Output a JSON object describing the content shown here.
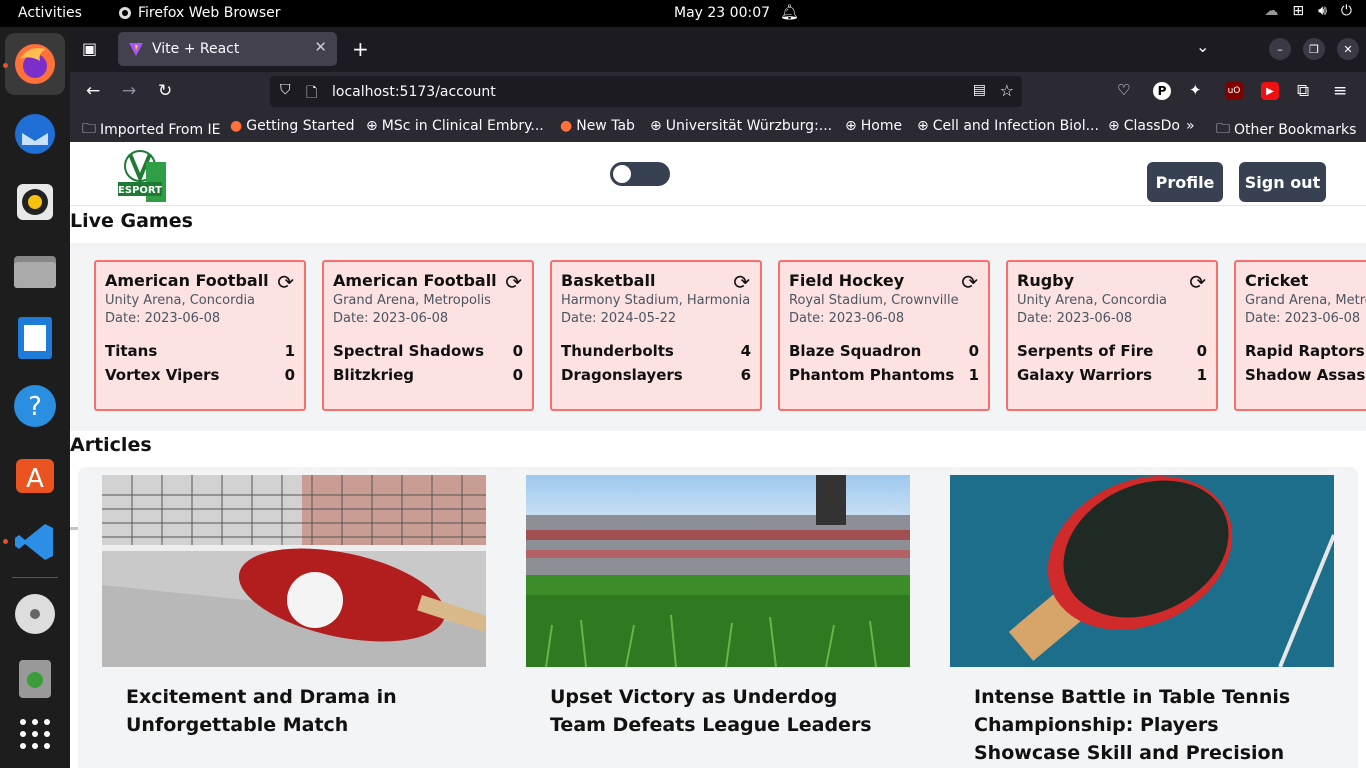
{
  "topbar": {
    "activities": "Activities",
    "app_name": "Firefox Web Browser",
    "clock": "May 23  00:07"
  },
  "browser": {
    "tab_title": "Vite + React",
    "url": "localhost:5173/account",
    "bookmarks": [
      "Imported From IE",
      "Getting Started",
      "MSc in Clinical Embry...",
      "New Tab",
      "Universität Würzburg:...",
      "Home",
      "Cell and Infection Biol...",
      "ClassDo",
      "Other Bookmarks"
    ]
  },
  "app": {
    "logo_text": "ESPORT",
    "profile_label": "Profile",
    "signout_label": "Sign out",
    "live_games_title": "Live Games",
    "articles_title": "Articles",
    "games": [
      {
        "sport": "American Football",
        "venue": "Unity Arena, Concordia",
        "date": "Date: 2023-06-08",
        "team1": "Titans",
        "score1": "1",
        "team2": "Vortex Vipers",
        "score2": "0"
      },
      {
        "sport": "American Football",
        "venue": "Grand Arena, Metropolis",
        "date": "Date: 2023-06-08",
        "team1": "Spectral Shadows",
        "score1": "0",
        "team2": "Blitzkrieg",
        "score2": "0"
      },
      {
        "sport": "Basketball",
        "venue": "Harmony Stadium, Harmonia",
        "date": "Date: 2024-05-22",
        "team1": "Thunderbolts",
        "score1": "4",
        "team2": "Dragonslayers",
        "score2": "6"
      },
      {
        "sport": "Field Hockey",
        "venue": "Royal Stadium, Crownville",
        "date": "Date: 2023-06-08",
        "team1": "Blaze Squadron",
        "score1": "0",
        "team2": "Phantom Phantoms",
        "score2": "1"
      },
      {
        "sport": "Rugby",
        "venue": "Unity Arena, Concordia",
        "date": "Date: 2023-06-08",
        "team1": "Serpents of Fire",
        "score1": "0",
        "team2": "Galaxy Warriors",
        "score2": "1"
      },
      {
        "sport": "Cricket",
        "venue": "Grand Arena, Metropolis",
        "date": "Date: 2023-06-08",
        "team1": "Rapid Raptors",
        "score1": "",
        "team2": "Shadow Assassins",
        "score2": ""
      }
    ],
    "articles": [
      {
        "title": "Excitement and Drama in Unforgettable Match"
      },
      {
        "title": "Upset Victory as Underdog Team Defeats League Leaders"
      },
      {
        "title": "Intense Battle in Table Tennis Championship: Players Showcase Skill and Precision"
      }
    ]
  }
}
